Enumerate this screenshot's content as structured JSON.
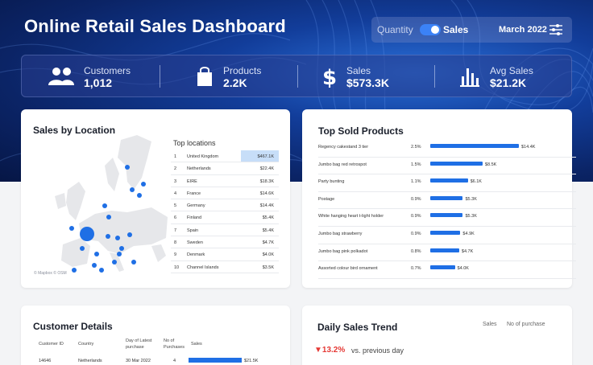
{
  "header": {
    "title": "Online Retail Sales Dashboard",
    "toggle_left": "Quantity",
    "toggle_right": "Sales",
    "period": "March 2022"
  },
  "kpis": [
    {
      "label": "Customers",
      "value": "1,012",
      "icon": "users-icon"
    },
    {
      "label": "Products",
      "value": "2.2K",
      "icon": "shopping-bag-icon"
    },
    {
      "label": "Sales",
      "value": "$573.3K",
      "icon": "dollar-icon"
    },
    {
      "label": "Avg Sales",
      "value": "$21.2K",
      "icon": "bar-chart-icon"
    }
  ],
  "location": {
    "title": "Sales by Location",
    "top_title": "Top locations",
    "credit": "© Mapbox © OSM",
    "rows": [
      {
        "rank": "1",
        "country": "United Kingdom",
        "value": "$467.1K"
      },
      {
        "rank": "2",
        "country": "Netherlands",
        "value": "$22.4K"
      },
      {
        "rank": "3",
        "country": "EIRE",
        "value": "$18.3K"
      },
      {
        "rank": "4",
        "country": "France",
        "value": "$14.6K"
      },
      {
        "rank": "5",
        "country": "Germany",
        "value": "$14.4K"
      },
      {
        "rank": "6",
        "country": "Finland",
        "value": "$5.4K"
      },
      {
        "rank": "7",
        "country": "Spain",
        "value": "$5.4K"
      },
      {
        "rank": "8",
        "country": "Sweden",
        "value": "$4.7K"
      },
      {
        "rank": "9",
        "country": "Denmark",
        "value": "$4.0K"
      },
      {
        "rank": "10",
        "country": "Channel Islands",
        "value": "$3.5K"
      }
    ]
  },
  "products": {
    "title": "Top Sold Products",
    "rows": [
      {
        "name": "Regency cakestand 3 tier",
        "pct": "2.5%",
        "value": "$14.4K",
        "amount": 14.4
      },
      {
        "name": "Jumbo bag red retrospot",
        "pct": "1.5%",
        "value": "$8.5K",
        "amount": 8.5
      },
      {
        "name": "Party bunting",
        "pct": "1.1%",
        "value": "$6.1K",
        "amount": 6.1
      },
      {
        "name": "Postage",
        "pct": "0.9%",
        "value": "$5.3K",
        "amount": 5.3
      },
      {
        "name": "White hanging heart t-light holder",
        "pct": "0.9%",
        "value": "$5.3K",
        "amount": 5.3
      },
      {
        "name": "Jumbo bag strawberry",
        "pct": "0.9%",
        "value": "$4.9K",
        "amount": 4.9
      },
      {
        "name": "Jumbo bag pink polkadot",
        "pct": "0.8%",
        "value": "$4.7K",
        "amount": 4.7
      },
      {
        "name": "Assorted colour bird ornament",
        "pct": "0.7%",
        "value": "$4.0K",
        "amount": 4.0
      }
    ]
  },
  "customers": {
    "title": "Customer Details",
    "headers": [
      "Customer ID",
      "Country",
      "Day of Latest purchase",
      "No of Purchases",
      "Sales"
    ],
    "rows": [
      {
        "id": "14646",
        "country": "Netherlands",
        "date": "30 Mar 2022",
        "purchases": "4",
        "sales": "$21.5K",
        "amount": 21.5
      }
    ]
  },
  "trend": {
    "title": "Daily Sales Trend",
    "legend_sales": "Sales",
    "legend_purchases": "No of purchase",
    "change": "▼13.2%",
    "change_note": "vs. previous day"
  },
  "colors": {
    "accent": "#1f6fe5",
    "negative": "#e53935",
    "highlight": "#c7def8"
  }
}
